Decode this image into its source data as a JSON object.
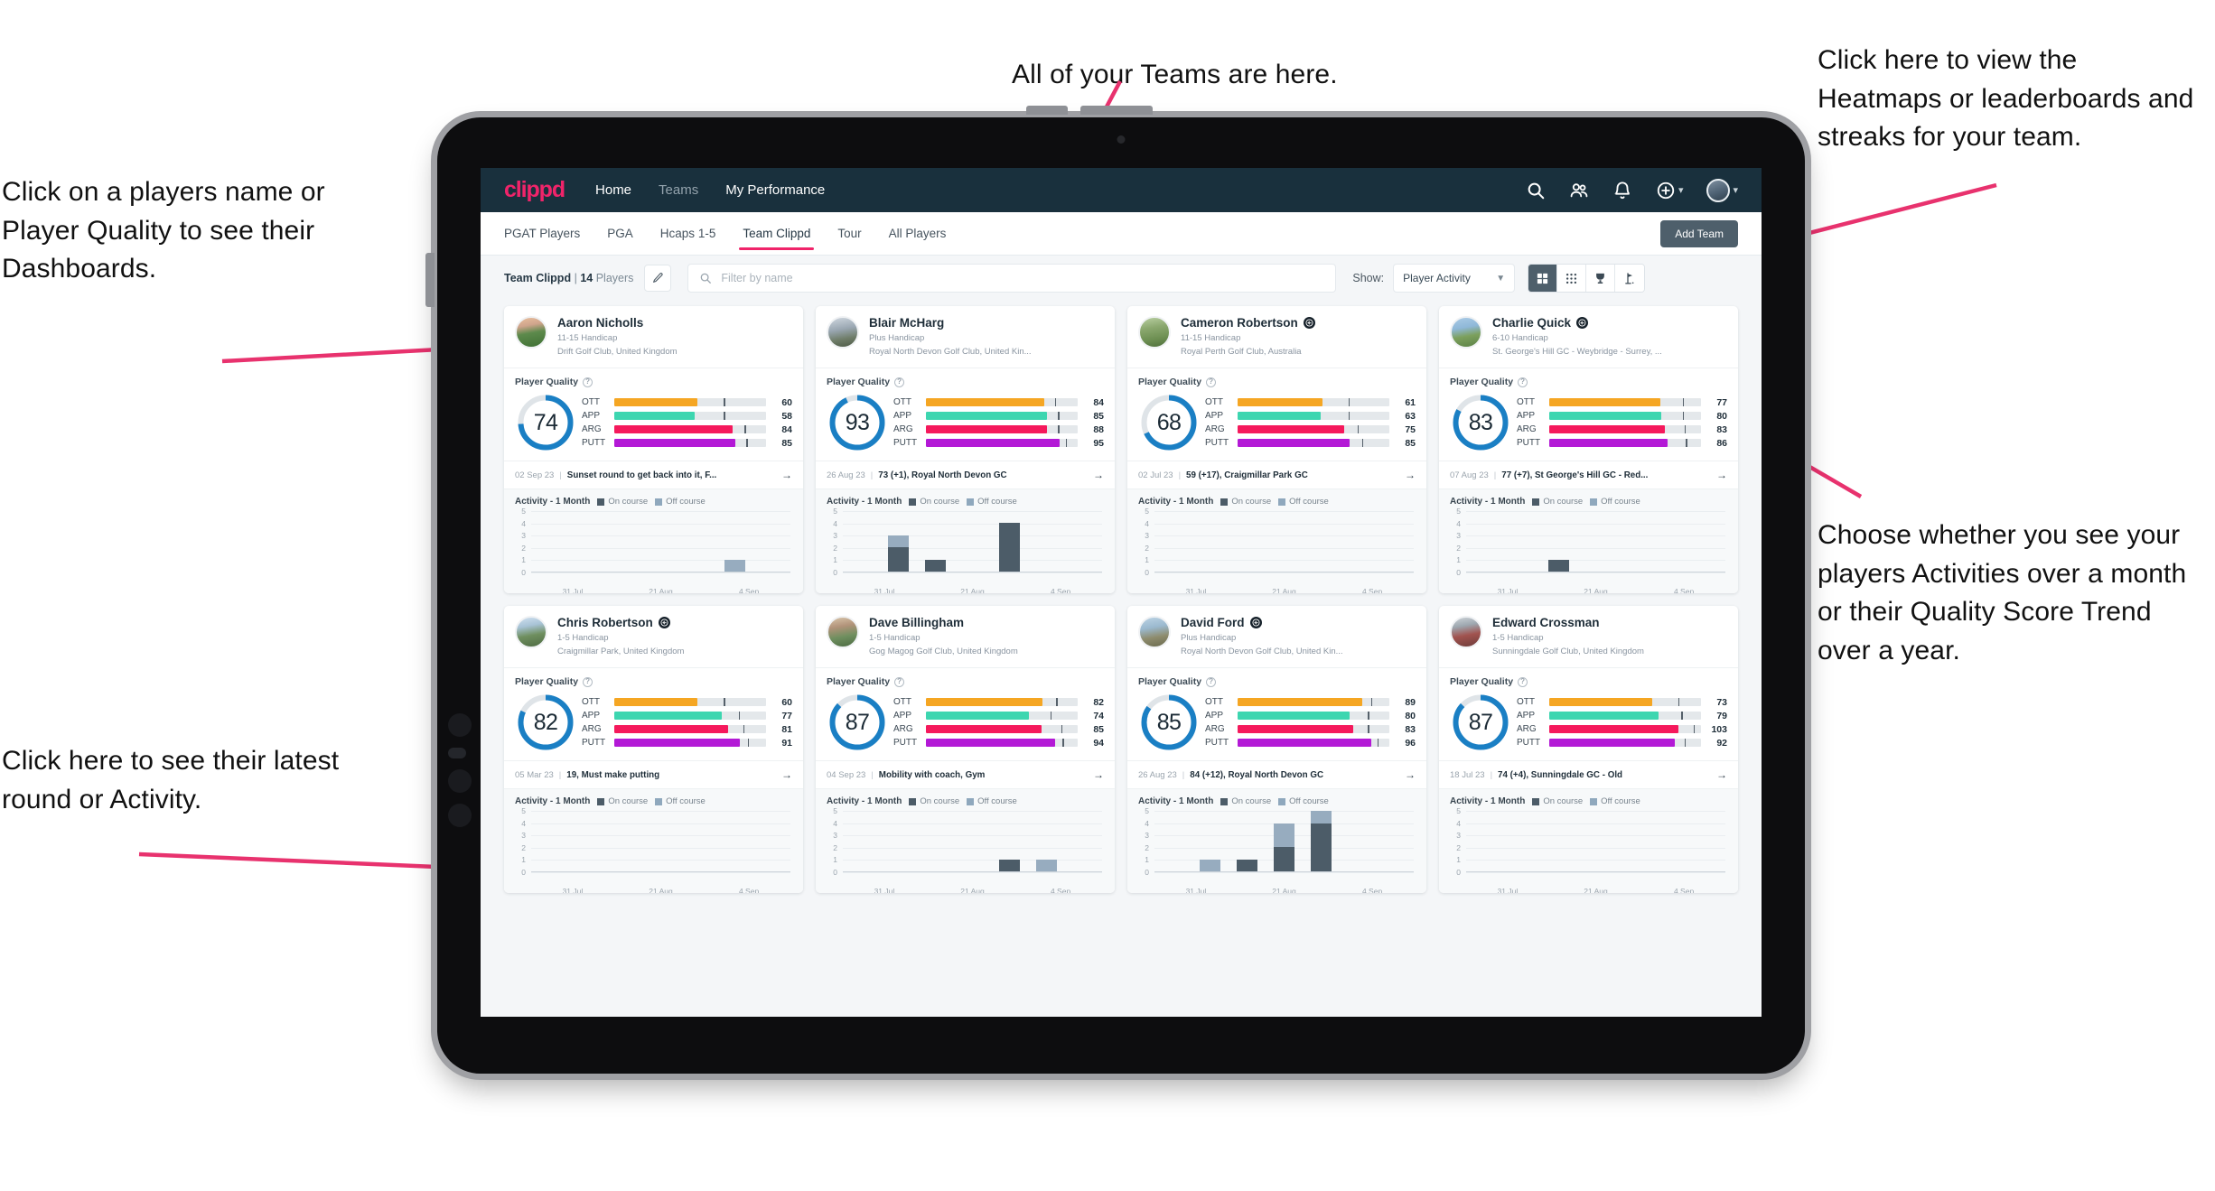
{
  "annotations": {
    "players": "Click on a players name or Player Quality to see their Dashboards.",
    "teams": "All of your Teams are here.",
    "heatmaps": "Click here to view the Heatmaps or leaderboards and streaks for your team.",
    "activity": "Choose whether you see your players Activities over a month or their Quality Score Trend over a year.",
    "latest": "Click here to see their latest round or Activity."
  },
  "app": {
    "logo": "clippd",
    "nav": [
      {
        "label": "Home",
        "active": true
      },
      {
        "label": "Teams",
        "active": false
      },
      {
        "label": "My Performance",
        "active": true
      }
    ],
    "icons": {
      "search": "search-icon",
      "people": "people-icon",
      "bell": "bell-icon",
      "plus": "plus-circle-icon",
      "avatar": "avatar"
    }
  },
  "tabs": [
    {
      "label": "PGAT Players",
      "active": false
    },
    {
      "label": "PGA",
      "active": false
    },
    {
      "label": "Hcaps 1-5",
      "active": false
    },
    {
      "label": "Team Clippd",
      "active": true
    },
    {
      "label": "Tour",
      "active": false
    },
    {
      "label": "All Players",
      "active": false
    }
  ],
  "toolbar": {
    "add_team_label": "Add Team",
    "team_name": "Team Clippd",
    "team_divider": "|",
    "player_count": "14",
    "players_word": "Players",
    "edit_icon": "pencil-icon",
    "search_placeholder": "Filter by name",
    "search_value": "",
    "show_label": "Show:",
    "show_value": "Player Activity",
    "views": [
      {
        "name": "grid-view-icon",
        "active": true
      },
      {
        "name": "dots-grid-view-icon",
        "active": false
      },
      {
        "name": "trophy-view-icon",
        "active": false
      },
      {
        "name": "flag-view-icon",
        "active": false
      }
    ]
  },
  "card_labels": {
    "player_quality": "Player Quality",
    "activity_title": "Activity - 1 Month",
    "legend_on": "On course",
    "legend_off": "Off course",
    "arrow": "→"
  },
  "colors": {
    "brand_pink": "#f0246a",
    "topbar": "#19303d",
    "ott": "#f5a623",
    "app": "#3dd6b0",
    "arg": "#f5195c",
    "putt": "#b319d6",
    "ring": "#1a7fc4",
    "on_course": "#4c5c68",
    "off_course": "#97acbf"
  },
  "chart_data": {
    "type": "bar",
    "title": "Activity - 1 Month",
    "ylim": [
      0,
      5
    ],
    "ytick_labels": [
      "5",
      "4",
      "3",
      "2",
      "1",
      "0"
    ],
    "xtick_labels": [
      "31 Jul",
      "21 Aug",
      "4 Sep"
    ],
    "series": [
      {
        "name": "On course",
        "color": "#4c5c68"
      },
      {
        "name": "Off course",
        "color": "#97acbf"
      }
    ]
  },
  "players": [
    {
      "name": "Aaron Nicholls",
      "verified": false,
      "handicap": "11-15 Handicap",
      "club": "Drift Golf Club, United Kingdom",
      "quality": 74,
      "avatar_class": "pa1",
      "metrics": [
        {
          "label": "OTT",
          "value": 60,
          "fill": 55,
          "tick": 72
        },
        {
          "label": "APP",
          "value": 58,
          "fill": 53,
          "tick": 72
        },
        {
          "label": "ARG",
          "value": 84,
          "fill": 78,
          "tick": 86
        },
        {
          "label": "PUTT",
          "value": 85,
          "fill": 80,
          "tick": 87
        }
      ],
      "round_date": "02 Sep 23",
      "round_text": "Sunset round to get back into it, F...",
      "activity": [
        {
          "on": 0,
          "off": 0
        },
        {
          "on": 0,
          "off": 0
        },
        {
          "on": 0,
          "off": 0
        },
        {
          "on": 0,
          "off": 0
        },
        {
          "on": 0,
          "off": 0
        },
        {
          "on": 0,
          "off": 1
        },
        {
          "on": 0,
          "off": 0
        }
      ]
    },
    {
      "name": "Blair McHarg",
      "verified": false,
      "handicap": "Plus Handicap",
      "club": "Royal North Devon Golf Club, United Kin...",
      "quality": 93,
      "avatar_class": "pa2",
      "metrics": [
        {
          "label": "OTT",
          "value": 84,
          "fill": 78,
          "tick": 85
        },
        {
          "label": "APP",
          "value": 85,
          "fill": 80,
          "tick": 87
        },
        {
          "label": "ARG",
          "value": 88,
          "fill": 80,
          "tick": 87
        },
        {
          "label": "PUTT",
          "value": 95,
          "fill": 88,
          "tick": 92
        }
      ],
      "round_date": "26 Aug 23",
      "round_text": "73 (+1), Royal North Devon GC",
      "activity": [
        {
          "on": 0,
          "off": 0
        },
        {
          "on": 2,
          "off": 1
        },
        {
          "on": 1,
          "off": 0
        },
        {
          "on": 0,
          "off": 0
        },
        {
          "on": 4,
          "off": 0
        },
        {
          "on": 0,
          "off": 0
        },
        {
          "on": 0,
          "off": 0
        }
      ]
    },
    {
      "name": "Cameron Robertson",
      "verified": true,
      "handicap": "11-15 Handicap",
      "club": "Royal Perth Golf Club, Australia",
      "quality": 68,
      "avatar_class": "pa3",
      "metrics": [
        {
          "label": "OTT",
          "value": 61,
          "fill": 56,
          "tick": 73
        },
        {
          "label": "APP",
          "value": 63,
          "fill": 55,
          "tick": 73
        },
        {
          "label": "ARG",
          "value": 75,
          "fill": 70,
          "tick": 79
        },
        {
          "label": "PUTT",
          "value": 85,
          "fill": 74,
          "tick": 82
        }
      ],
      "round_date": "02 Jul 23",
      "round_text": "59 (+17), Craigmillar Park GC",
      "activity": [
        {
          "on": 0,
          "off": 0
        },
        {
          "on": 0,
          "off": 0
        },
        {
          "on": 0,
          "off": 0
        },
        {
          "on": 0,
          "off": 0
        },
        {
          "on": 0,
          "off": 0
        },
        {
          "on": 0,
          "off": 0
        },
        {
          "on": 0,
          "off": 0
        }
      ]
    },
    {
      "name": "Charlie Quick",
      "verified": true,
      "handicap": "6-10 Handicap",
      "club": "St. George's Hill GC - Weybridge - Surrey, ...",
      "quality": 83,
      "avatar_class": "pa4",
      "metrics": [
        {
          "label": "OTT",
          "value": 77,
          "fill": 73,
          "tick": 88
        },
        {
          "label": "APP",
          "value": 80,
          "fill": 74,
          "tick": 88
        },
        {
          "label": "ARG",
          "value": 83,
          "fill": 76,
          "tick": 89
        },
        {
          "label": "PUTT",
          "value": 86,
          "fill": 78,
          "tick": 90
        }
      ],
      "round_date": "07 Aug 23",
      "round_text": "77 (+7), St George's Hill GC - Red...",
      "activity": [
        {
          "on": 0,
          "off": 0
        },
        {
          "on": 0,
          "off": 0
        },
        {
          "on": 1,
          "off": 0
        },
        {
          "on": 0,
          "off": 0
        },
        {
          "on": 0,
          "off": 0
        },
        {
          "on": 0,
          "off": 0
        },
        {
          "on": 0,
          "off": 0
        }
      ]
    },
    {
      "name": "Chris Robertson",
      "verified": true,
      "handicap": "1-5 Handicap",
      "club": "Craigmillar Park, United Kingdom",
      "quality": 82,
      "avatar_class": "pa5",
      "metrics": [
        {
          "label": "OTT",
          "value": 60,
          "fill": 55,
          "tick": 72
        },
        {
          "label": "APP",
          "value": 77,
          "fill": 71,
          "tick": 82
        },
        {
          "label": "ARG",
          "value": 81,
          "fill": 75,
          "tick": 85
        },
        {
          "label": "PUTT",
          "value": 91,
          "fill": 83,
          "tick": 88
        }
      ],
      "round_date": "05 Mar 23",
      "round_text": "19, Must make putting",
      "activity": [
        {
          "on": 0,
          "off": 0
        },
        {
          "on": 0,
          "off": 0
        },
        {
          "on": 0,
          "off": 0
        },
        {
          "on": 0,
          "off": 0
        },
        {
          "on": 0,
          "off": 0
        },
        {
          "on": 0,
          "off": 0
        },
        {
          "on": 0,
          "off": 0
        }
      ]
    },
    {
      "name": "Dave Billingham",
      "verified": false,
      "handicap": "1-5 Handicap",
      "club": "Gog Magog Golf Club, United Kingdom",
      "quality": 87,
      "avatar_class": "pa6",
      "metrics": [
        {
          "label": "OTT",
          "value": 82,
          "fill": 77,
          "tick": 86
        },
        {
          "label": "APP",
          "value": 74,
          "fill": 68,
          "tick": 82
        },
        {
          "label": "ARG",
          "value": 85,
          "fill": 76,
          "tick": 89
        },
        {
          "label": "PUTT",
          "value": 94,
          "fill": 85,
          "tick": 90
        }
      ],
      "round_date": "04 Sep 23",
      "round_text": "Mobility with coach, Gym",
      "activity": [
        {
          "on": 0,
          "off": 0
        },
        {
          "on": 0,
          "off": 0
        },
        {
          "on": 0,
          "off": 0
        },
        {
          "on": 0,
          "off": 0
        },
        {
          "on": 1,
          "off": 0
        },
        {
          "on": 0,
          "off": 1
        },
        {
          "on": 0,
          "off": 0
        }
      ]
    },
    {
      "name": "David Ford",
      "verified": true,
      "handicap": "Plus Handicap",
      "club": "Royal North Devon Golf Club, United Kin...",
      "quality": 85,
      "avatar_class": "pa7",
      "metrics": [
        {
          "label": "OTT",
          "value": 89,
          "fill": 82,
          "tick": 88
        },
        {
          "label": "APP",
          "value": 80,
          "fill": 74,
          "tick": 86
        },
        {
          "label": "ARG",
          "value": 83,
          "fill": 76,
          "tick": 86
        },
        {
          "label": "PUTT",
          "value": 96,
          "fill": 88,
          "tick": 92
        }
      ],
      "round_date": "26 Aug 23",
      "round_text": "84 (+12), Royal North Devon GC",
      "activity": [
        {
          "on": 0,
          "off": 0
        },
        {
          "on": 0,
          "off": 1
        },
        {
          "on": 1,
          "off": 0
        },
        {
          "on": 2,
          "off": 2
        },
        {
          "on": 4,
          "off": 1
        },
        {
          "on": 0,
          "off": 0
        },
        {
          "on": 0,
          "off": 0
        }
      ]
    },
    {
      "name": "Edward Crossman",
      "verified": false,
      "handicap": "1-5 Handicap",
      "club": "Sunningdale Golf Club, United Kingdom",
      "quality": 87,
      "avatar_class": "pa8",
      "metrics": [
        {
          "label": "OTT",
          "value": 73,
          "fill": 68,
          "tick": 85
        },
        {
          "label": "APP",
          "value": 79,
          "fill": 72,
          "tick": 87
        },
        {
          "label": "ARG",
          "value": 103,
          "fill": 85,
          "tick": 95
        },
        {
          "label": "PUTT",
          "value": 92,
          "fill": 83,
          "tick": 89
        }
      ],
      "round_date": "18 Jul 23",
      "round_text": "74 (+4), Sunningdale GC - Old",
      "activity": [
        {
          "on": 0,
          "off": 0
        },
        {
          "on": 0,
          "off": 0
        },
        {
          "on": 0,
          "off": 0
        },
        {
          "on": 0,
          "off": 0
        },
        {
          "on": 0,
          "off": 0
        },
        {
          "on": 0,
          "off": 0
        },
        {
          "on": 0,
          "off": 0
        }
      ]
    }
  ]
}
